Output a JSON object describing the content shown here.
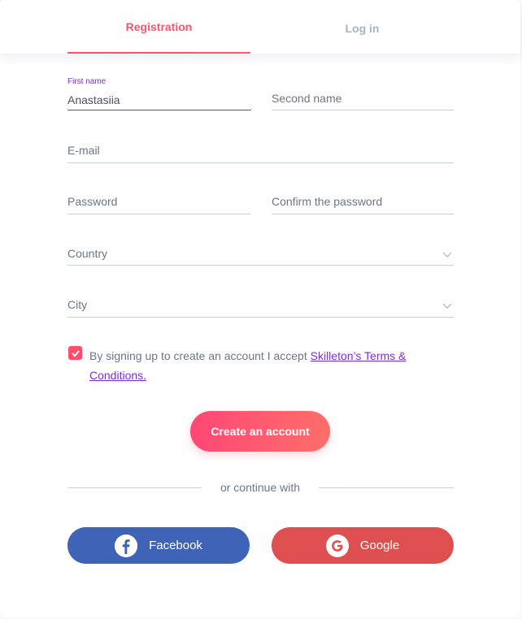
{
  "tabs": {
    "registration": "Registration",
    "login": "Log in"
  },
  "form": {
    "first_name_label": "First name",
    "first_name_value": "Anastasiia",
    "second_name_label": "Second name",
    "email_label": "E-mail",
    "password_label": "Password",
    "confirm_password_label": "Confirm the password",
    "country_label": "Country",
    "city_label": "City",
    "terms_text": "By signing up to create an account I accept ",
    "terms_link": "Skilleton’s Terms & Conditions.",
    "terms_checked": true
  },
  "actions": {
    "create_account": "Create an account",
    "divider": "or continue with",
    "facebook": "Facebook",
    "google": "Google"
  },
  "colors": {
    "accent": "#ff4f6d",
    "link": "#7b2fd8",
    "facebook": "#3f63b6",
    "google": "#de5050"
  },
  "icons": [
    "chevron-down-icon",
    "check-icon",
    "facebook-icon",
    "google-icon"
  ]
}
